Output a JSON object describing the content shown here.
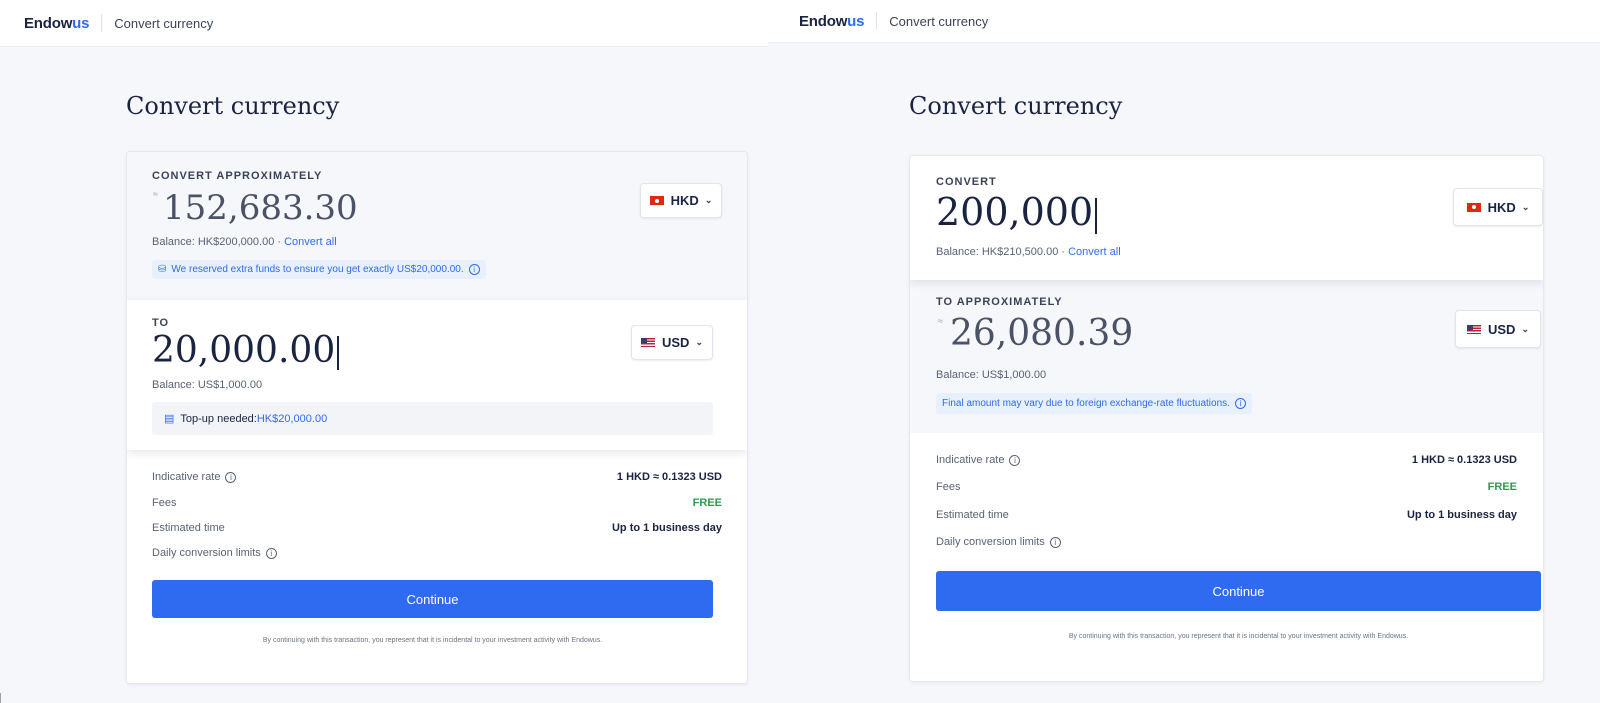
{
  "brand": {
    "logo_main": "Endow",
    "logo_accent": "us",
    "colors": {
      "brand_blue": "#2f6bf0",
      "navy": "#1a2340",
      "success_green": "#2e9b50"
    }
  },
  "left": {
    "topbar_title": "Convert currency",
    "page_title": "Convert currency",
    "from": {
      "label": "CONVERT APPROXIMATELY",
      "approx_symbol": "≈",
      "amount": "152,683.30",
      "currency": "HKD",
      "flag_icon": "hk-flag-icon",
      "balance_text": "Balance: HK$200,000.00 · ",
      "convert_all": "Convert all",
      "notice": "We reserved extra funds to ensure you get exactly US$20,000.00."
    },
    "to": {
      "label": "TO",
      "amount": "20,000.00",
      "currency": "USD",
      "flag_icon": "us-flag-icon",
      "balance_text": "Balance: US$1,000.00",
      "topup_label": "Top-up needed: ",
      "topup_amount": "HK$20,000.00"
    },
    "details": {
      "rate_label": "Indicative rate",
      "rate_value": "1 HKD ≈ 0.1323 USD",
      "fees_label": "Fees",
      "fees_value": "FREE",
      "time_label": "Estimated time",
      "time_value": "Up to 1 business day",
      "limits_label": "Daily conversion limits"
    },
    "continue_label": "Continue",
    "disclaimer": "By continuing with this transaction, you represent that it is incidental to your investment activity with Endowus."
  },
  "right": {
    "topbar_title": "Convert currency",
    "page_title": "Convert currency",
    "from": {
      "label": "CONVERT",
      "amount": "200,000",
      "currency": "HKD",
      "flag_icon": "hk-flag-icon",
      "balance_text": "Balance: HK$210,500.00 · ",
      "convert_all": "Convert all"
    },
    "to": {
      "label": "TO APPROXIMATELY",
      "approx_symbol": "≈",
      "amount": "26,080.39",
      "currency": "USD",
      "flag_icon": "us-flag-icon",
      "balance_text": "Balance: US$1,000.00",
      "notice": "Final amount may vary due to foreign exchange-rate fluctuations."
    },
    "details": {
      "rate_label": "Indicative rate",
      "rate_value": "1 HKD ≈ 0.1323 USD",
      "fees_label": "Fees",
      "fees_value": "FREE",
      "time_label": "Estimated time",
      "time_value": "Up to 1 business day",
      "limits_label": "Daily conversion limits"
    },
    "continue_label": "Continue",
    "disclaimer": "By continuing with this transaction, you represent that it is incidental to your investment activity with Endowus."
  }
}
